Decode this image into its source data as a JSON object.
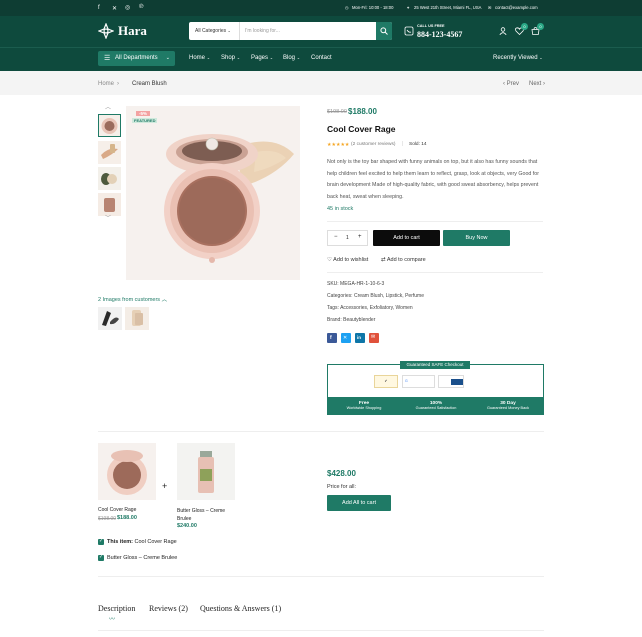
{
  "topbar": {
    "hours": "Mon-Fri: 10:00 - 18:00",
    "address": "25 West 21th Street, Miami FL, USA",
    "email": "contact@example.com"
  },
  "header": {
    "logo": "Hara",
    "search_category": "All Categories",
    "search_placeholder": "I'm looking for...",
    "call_label": "CALL US FREE",
    "phone": "884-123-4567",
    "wishlist_count": "0",
    "cart_count": "0"
  },
  "nav": {
    "departments": "All Departments",
    "items": [
      "Home",
      "Shop",
      "Pages",
      "Blog",
      "Contact"
    ],
    "recently_viewed": "Recently Viewed"
  },
  "breadcrumb": {
    "home": "Home",
    "current": "Cream Blush",
    "prev": "Prev",
    "next": "Next"
  },
  "product": {
    "badge_sale": "-5%",
    "badge_featured": "FEATURED",
    "old_price": "$198.00",
    "price": "$188.00",
    "title": "Cool Cover Rage",
    "reviews": "(2 customer reviews)",
    "sold": "Sold: 14",
    "description": "Not only is the toy bar shaped with funny animals on top, but it also has funny sounds that help children feel excited to help them learn to reflect, grasp, look at objects, very Good for brain development Made of high-quality fabric, with good sweat absorbency, helps prevent back heat, sweat when sleeping.",
    "stock": "45 in stock",
    "qty": "1",
    "add_to_cart": "Add to cart",
    "buy_now": "Buy Now",
    "wishlist": "Add to wishlist",
    "compare": "Add to compare",
    "sku": "SKU: MEGA-HR-1-10-6-3",
    "categories": "Categories: Cream Blush, Lipstick, Perfume",
    "tags": "Tags: Accessories, Exfoliatory, Women",
    "brand": "Brand: Beautyblender",
    "images_from_customers": "2 Images from customers"
  },
  "checkout": {
    "title": "Guaranteed SAFE Checkout",
    "features": [
      {
        "title": "Free",
        "sub": "Worldwide Shopping"
      },
      {
        "title": "100%",
        "sub": "Guaranteed Satisfaction"
      },
      {
        "title": "30 Day",
        "sub": "Guaranteed Money Back"
      }
    ]
  },
  "bundle": {
    "plus": "+",
    "items": [
      {
        "name": "Cool Cover Rage",
        "old": "$198.00",
        "price": "$188.00"
      },
      {
        "name": "Butter Gloss – Creme Brulee",
        "price": "$240.00"
      }
    ],
    "total": "$428.00",
    "price_for_all": "Price for all:",
    "add_all": "Add All to cart",
    "check1_bold": "This item:",
    "check1": "Cool Cover Rage",
    "check2": "Butter Gloss – Creme Brulee"
  },
  "tabs": [
    "Description",
    "Reviews (2)",
    "Questions & Answers (1)"
  ],
  "colors": {
    "dark": "#0e4a3d",
    "accent": "#1f7a66",
    "price": "#1f7a66"
  }
}
